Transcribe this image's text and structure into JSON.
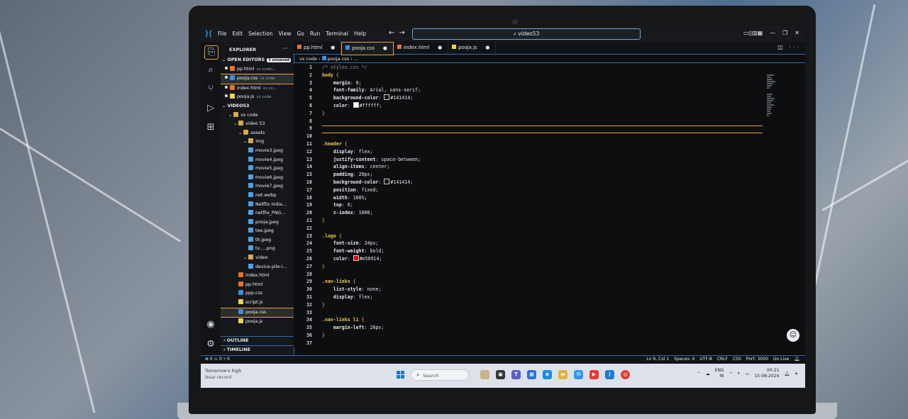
{
  "titlebar": {
    "menu": [
      "File",
      "Edit",
      "Selection",
      "View",
      "Go",
      "Run",
      "Terminal",
      "Help"
    ],
    "search": "video53"
  },
  "sidebar": {
    "header": "EXPLORER",
    "open_editors": "OPEN EDITORS",
    "unsaved": "3 unsaved",
    "open_files": [
      {
        "name": "pp.html",
        "path": "vs code\\...",
        "type": "html"
      },
      {
        "name": "pooja.css",
        "path": "vs code",
        "type": "css"
      },
      {
        "name": "index.html",
        "path": "vs co...",
        "type": "html"
      },
      {
        "name": "pooja.js",
        "path": "vs code",
        "type": "js"
      }
    ],
    "workspace": "VIDEO53",
    "tree": [
      {
        "name": "vs code",
        "type": "folder",
        "depth": 1
      },
      {
        "name": "video 53",
        "type": "folder",
        "depth": 2
      },
      {
        "name": "assets",
        "type": "folder",
        "depth": 3
      },
      {
        "name": "img",
        "type": "folder",
        "depth": 4
      },
      {
        "name": "movie3.jpeg",
        "type": "img",
        "depth": 5
      },
      {
        "name": "movie4.jpeg",
        "type": "img",
        "depth": 5
      },
      {
        "name": "movie5.jpeg",
        "type": "img",
        "depth": 5
      },
      {
        "name": "movie6.jpeg",
        "type": "img",
        "depth": 5
      },
      {
        "name": "movie7.jpeg",
        "type": "img",
        "depth": 5
      },
      {
        "name": "net.webp",
        "type": "img",
        "depth": 5
      },
      {
        "name": "Netflix India...",
        "type": "img",
        "depth": 5
      },
      {
        "name": "netflix_PNG...",
        "type": "img",
        "depth": 5
      },
      {
        "name": "pooja.jpeg",
        "type": "img",
        "depth": 5
      },
      {
        "name": "tee.jpeg",
        "type": "img",
        "depth": 5
      },
      {
        "name": "th.jpeg",
        "type": "img",
        "depth": 5
      },
      {
        "name": "tv.....png",
        "type": "img",
        "depth": 5
      },
      {
        "name": "video",
        "type": "folder",
        "depth": 4
      },
      {
        "name": "device-pile-i...",
        "type": "img",
        "depth": 5
      },
      {
        "name": "index.html",
        "type": "html",
        "depth": 3
      },
      {
        "name": "pp.html",
        "type": "html",
        "depth": 3
      },
      {
        "name": "ppp.css",
        "type": "css",
        "depth": 3
      },
      {
        "name": "script.js",
        "type": "js",
        "depth": 3
      },
      {
        "name": "pooja.css",
        "type": "css",
        "depth": 3
      },
      {
        "name": "pooja.js",
        "type": "js",
        "depth": 3
      }
    ],
    "outline": "OUTLINE",
    "timeline": "TIMELINE"
  },
  "tabs": [
    {
      "name": "pp.html",
      "type": "html"
    },
    {
      "name": "pooja.css",
      "type": "css"
    },
    {
      "name": "index.html",
      "type": "html"
    },
    {
      "name": "pooja.js",
      "type": "js"
    }
  ],
  "breadcrumb": {
    "folder": "vs code",
    "file": "pooja.css",
    "rest": "..."
  },
  "editor": {
    "lines": [
      "/* styles.css */",
      "body {",
      "    margin: 0;",
      "    font-family: Arial, sans-serif;",
      "    background-color: #141414;",
      "    color: #ffffff;",
      "}",
      "",
      "",
      "",
      ".header {",
      "    display: flex;",
      "    justify-content: space-between;",
      "    align-items: center;",
      "    padding: 20px;",
      "    background-color: #141414;",
      "    position: fixed;",
      "    width: 100%;",
      "    top: 0;",
      "    z-index: 1000;",
      "}",
      "",
      ".logo {",
      "    font-size: 24px;",
      "    font-weight: bold;",
      "    color: #e50914;",
      "}",
      "",
      ".nav-links {",
      "    list-style: none;",
      "    display: flex;",
      "}",
      "",
      ".nav-links li {",
      "    margin-left: 20px;",
      "}",
      ""
    ],
    "current_line": 9
  },
  "status": {
    "left": "⊗ 0 ⚠ 0   ⑂ 0",
    "position": "Ln 9, Col 1",
    "spaces": "Spaces: 4",
    "encoding": "UTF-8",
    "eol": "CRLF",
    "language": "CSS",
    "port": "Port: 3000",
    "golive": "Go Live"
  },
  "taskbar": {
    "weather_title": "Tomorrow's high",
    "weather_sub": "Near record",
    "search": "Search",
    "lang": "ENG",
    "lang_sub": "IN",
    "time": "00:21",
    "date": "15-08-2024"
  },
  "colors": {
    "accent": "#e7a33b",
    "border": "#2e6fb0",
    "editor_bg": "#0d0e10"
  }
}
